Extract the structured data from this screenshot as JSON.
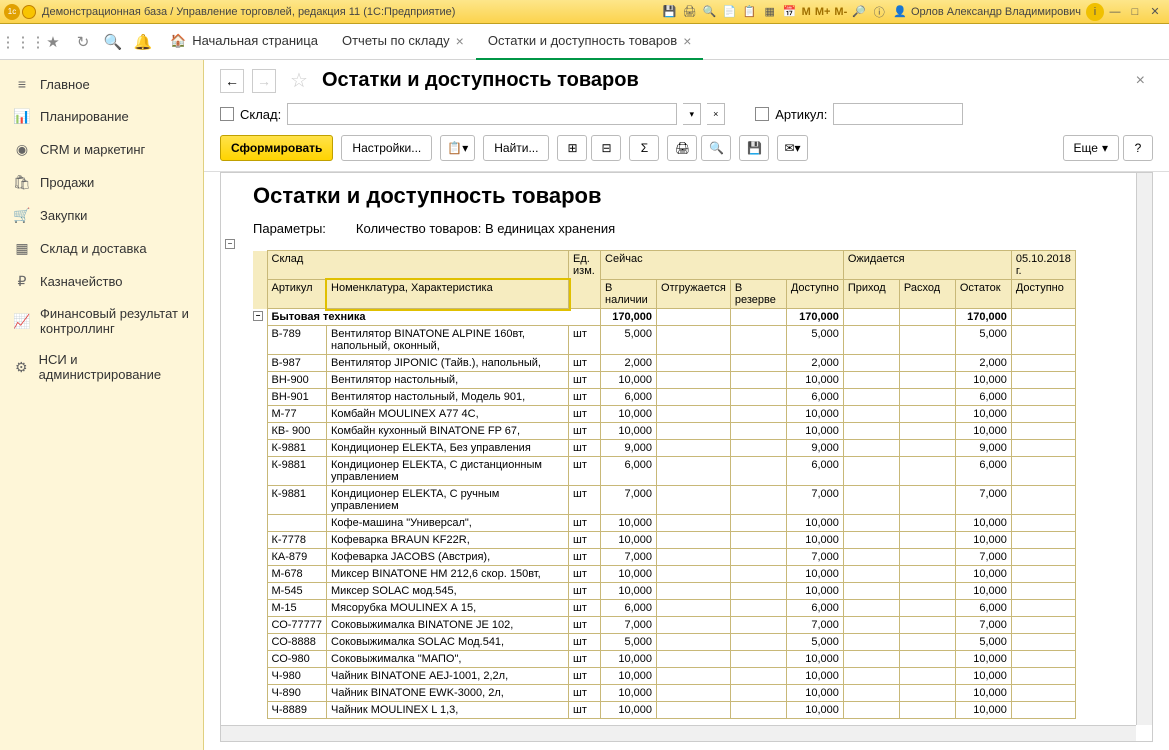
{
  "titlebar": {
    "title": "Демонстрационная база / Управление торговлей, редакция 11 (1С:Предприятие)",
    "user": "Орлов Александр Владимирович",
    "m": "M",
    "mplus": "M+",
    "mminus": "M-"
  },
  "tabs": {
    "home": "Начальная страница",
    "t1": "Отчеты по складу",
    "t2": "Остатки и доступность товаров"
  },
  "sidebar": {
    "items": [
      {
        "icon": "≡",
        "label": "Главное"
      },
      {
        "icon": "📊",
        "label": "Планирование"
      },
      {
        "icon": "◉",
        "label": "CRM и маркетинг"
      },
      {
        "icon": "🛍",
        "label": "Продажи"
      },
      {
        "icon": "🛒",
        "label": "Закупки"
      },
      {
        "icon": "▦",
        "label": "Склад и доставка"
      },
      {
        "icon": "₽",
        "label": "Казначейство"
      },
      {
        "icon": "📈",
        "label": "Финансовый результат и контроллинг"
      },
      {
        "icon": "⚙",
        "label": "НСИ и администрирование"
      }
    ]
  },
  "page": {
    "title": "Остатки и доступность товаров",
    "filter_warehouse_label": "Склад:",
    "filter_article_label": "Артикул:",
    "btn_form": "Сформировать",
    "btn_settings": "Настройки...",
    "btn_find": "Найти...",
    "btn_more": "Еще",
    "report_title": "Остатки и доступность товаров",
    "params_label": "Параметры:",
    "params_value": "Количество товаров: В единицах хранения"
  },
  "table": {
    "headers": {
      "warehouse": "Склад",
      "article": "Артикул",
      "nomenclature": "Номенклатура, Характеристика",
      "unit": "Ед. изм.",
      "now": "Сейчас",
      "in_stock": "В наличии",
      "shipping": "Отгружается",
      "reserve": "В резерве",
      "available": "Доступно",
      "expected": "Ожидается",
      "arrival": "Приход",
      "consumption": "Расход",
      "remainder": "Остаток",
      "date": "05.10.2018 г.",
      "available2": "Доступно"
    },
    "group": {
      "name": "Бытовая техника",
      "in_stock": "170,000",
      "available": "170,000",
      "remainder": "170,000"
    },
    "rows": [
      {
        "art": "В-789",
        "nom": "Вентилятор BINATONE ALPINE 160вт, напольный, оконный,",
        "ed": "шт",
        "stock": "5,000",
        "avail": "5,000",
        "rem": "5,000"
      },
      {
        "art": "В-987",
        "nom": "Вентилятор JIPONIC (Тайв.), напольный,",
        "ed": "шт",
        "stock": "2,000",
        "avail": "2,000",
        "rem": "2,000"
      },
      {
        "art": "ВН-900",
        "nom": "Вентилятор настольный,",
        "ed": "шт",
        "stock": "10,000",
        "avail": "10,000",
        "rem": "10,000"
      },
      {
        "art": "ВН-901",
        "nom": "Вентилятор настольный, Модель 901,",
        "ed": "шт",
        "stock": "6,000",
        "avail": "6,000",
        "rem": "6,000"
      },
      {
        "art": "М-77",
        "nom": "Комбайн MOULINEX  А77 4С,",
        "ed": "шт",
        "stock": "10,000",
        "avail": "10,000",
        "rem": "10,000"
      },
      {
        "art": "КВ- 900",
        "nom": "Комбайн кухонный BINATONE FP 67,",
        "ed": "шт",
        "stock": "10,000",
        "avail": "10,000",
        "rem": "10,000"
      },
      {
        "art": "К-9881",
        "nom": "Кондиционер ELEKTA, Без управления",
        "ed": "шт",
        "stock": "9,000",
        "avail": "9,000",
        "rem": "9,000"
      },
      {
        "art": "К-9881",
        "nom": "Кондиционер ELEKTA, С дистанционным управлением",
        "ed": "шт",
        "stock": "6,000",
        "avail": "6,000",
        "rem": "6,000"
      },
      {
        "art": "К-9881",
        "nom": "Кондиционер ELEKTA, С ручным управлением",
        "ed": "шт",
        "stock": "7,000",
        "avail": "7,000",
        "rem": "7,000"
      },
      {
        "art": "",
        "nom": "Кофе-машина \"Универсал\",",
        "ed": "шт",
        "stock": "10,000",
        "avail": "10,000",
        "rem": "10,000"
      },
      {
        "art": "К-7778",
        "nom": "Кофеварка BRAUN KF22R,",
        "ed": "шт",
        "stock": "10,000",
        "avail": "10,000",
        "rem": "10,000"
      },
      {
        "art": "КА-879",
        "nom": "Кофеварка JACOBS (Австрия),",
        "ed": "шт",
        "stock": "7,000",
        "avail": "7,000",
        "rem": "7,000"
      },
      {
        "art": "М-678",
        "nom": "Миксер BINATONE HM 212,6 скор. 150вт,",
        "ed": "шт",
        "stock": "10,000",
        "avail": "10,000",
        "rem": "10,000"
      },
      {
        "art": "М-545",
        "nom": "Миксер SOLAC мод.545,",
        "ed": "шт",
        "stock": "10,000",
        "avail": "10,000",
        "rem": "10,000"
      },
      {
        "art": "М-15",
        "nom": "Мясорубка MOULINEX  А 15,",
        "ed": "шт",
        "stock": "6,000",
        "avail": "6,000",
        "rem": "6,000"
      },
      {
        "art": "СО-77777",
        "nom": "Соковыжималка  BINATONE JE 102,",
        "ed": "шт",
        "stock": "7,000",
        "avail": "7,000",
        "rem": "7,000"
      },
      {
        "art": "СО-8888",
        "nom": "Соковыжималка  SOLAC  Мод.541,",
        "ed": "шт",
        "stock": "5,000",
        "avail": "5,000",
        "rem": "5,000"
      },
      {
        "art": "СО-980",
        "nom": "Соковыжималка \"МАПО\",",
        "ed": "шт",
        "stock": "10,000",
        "avail": "10,000",
        "rem": "10,000"
      },
      {
        "art": "Ч-980",
        "nom": "Чайник BINATONE  АЕJ-1001,  2,2л,",
        "ed": "шт",
        "stock": "10,000",
        "avail": "10,000",
        "rem": "10,000"
      },
      {
        "art": "Ч-890",
        "nom": "Чайник BINATONE  EWK-3000,  2л,",
        "ed": "шт",
        "stock": "10,000",
        "avail": "10,000",
        "rem": "10,000"
      },
      {
        "art": "Ч-8889",
        "nom": "Чайник MOULINEX L 1,3,",
        "ed": "шт",
        "stock": "10,000",
        "avail": "10,000",
        "rem": "10,000"
      }
    ]
  }
}
